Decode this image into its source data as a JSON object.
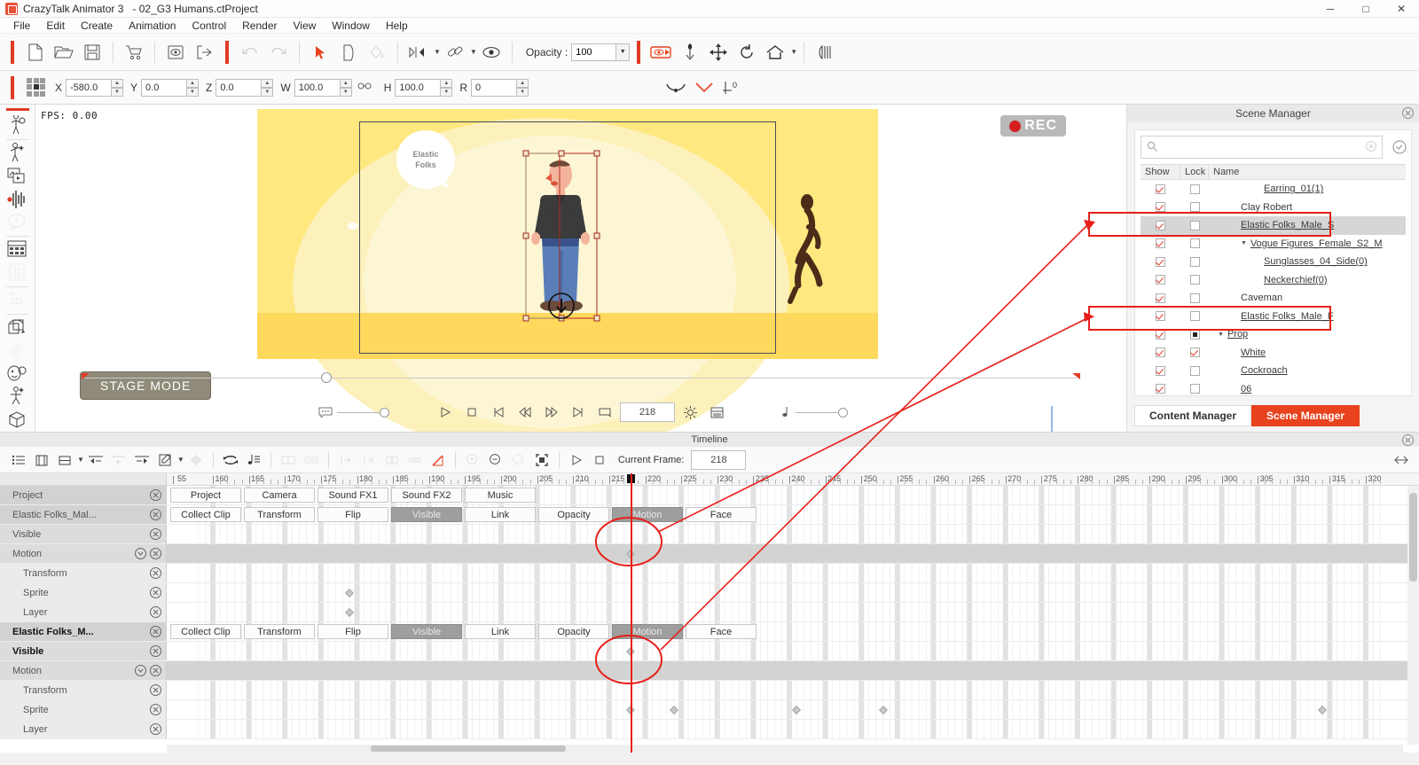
{
  "window": {
    "app_name": "CrazyTalk Animator 3",
    "document": "- 02_G3 Humans.ctProject",
    "minimize": "─",
    "maximize": "□",
    "close": "✕"
  },
  "menu": [
    "File",
    "Edit",
    "Create",
    "Animation",
    "Control",
    "Render",
    "View",
    "Window",
    "Help"
  ],
  "toolbar": {
    "opacity_label": "Opacity :",
    "opacity_value": "100",
    "icons": [
      "new-document-icon",
      "open-folder-icon",
      "save-disk-icon",
      "shopping-cart-icon",
      "preview-eye-icon",
      "export-icon",
      "undo-icon",
      "redo-icon",
      "select-arrow-icon",
      "duplicate-icon",
      "paint-bucket-icon",
      "keyframe-nav-icon",
      "link-bone-icon",
      "eye-visible-icon",
      "render-record-icon",
      "pin-icon",
      "move-icon",
      "rotate-icon",
      "home-icon",
      "composer-icon"
    ]
  },
  "transform": {
    "x_label": "X",
    "x_value": "-580.0",
    "y_label": "Y",
    "y_value": "0.0",
    "z_label": "Z",
    "z_value": "0.0",
    "w_label": "W",
    "w_value": "100.0",
    "h_label": "H",
    "h_value": "100.0",
    "r_label": "R",
    "r_value": "0",
    "zero_label": "0"
  },
  "rail": {
    "items": [
      {
        "name": "character-composer-icon",
        "enabled": true
      },
      {
        "name": "animation-puppet-icon",
        "enabled": true
      },
      {
        "name": "media-clip-icon",
        "enabled": true
      },
      {
        "name": "audio-waveform-icon",
        "enabled": true
      },
      {
        "name": "text-bubble-icon",
        "enabled": false
      },
      {
        "name": "sprite-editor-icon",
        "enabled": true
      },
      {
        "name": "bone-editor-icon",
        "enabled": false
      },
      {
        "name": "three-d-icon",
        "enabled": false
      },
      {
        "name": "layer-flip-icon",
        "enabled": true
      },
      {
        "name": "hand-gesture-icon",
        "enabled": false
      },
      {
        "name": "face-puppet-icon",
        "enabled": true
      },
      {
        "name": "motion-puppet-icon",
        "enabled": true
      },
      {
        "name": "box-prop-icon",
        "enabled": true
      }
    ]
  },
  "stage": {
    "fps": "FPS: 0.00",
    "rec_badge": "REC",
    "mode_badge": "STAGE MODE",
    "speech_bubble": "Elastic\nFolks",
    "speech_bubble_line1": "Elastic",
    "speech_bubble_line2": "Folks"
  },
  "transport": {
    "frame_value": "218",
    "buttons": [
      "play-icon",
      "stop-icon",
      "jump-start-icon",
      "step-back-icon",
      "step-forward-icon",
      "jump-end-icon",
      "loop-icon"
    ],
    "settings_icon": "gear-icon",
    "list_icon": "list-icon",
    "note_icon": "music-note-icon",
    "bubble_icon": "speech-bubble-icon"
  },
  "scene_manager": {
    "title": "Scene Manager",
    "search_placeholder": "",
    "search_value": "",
    "columns": [
      "Show",
      "Lock",
      "Name"
    ],
    "rows": [
      {
        "name": "Earring_01(1)",
        "show": true,
        "lock": false,
        "indent": 2,
        "expander": "",
        "selected": false,
        "highlight": false,
        "underline": true
      },
      {
        "name": "Clay Robert",
        "show": true,
        "lock": false,
        "indent": 1,
        "expander": "",
        "selected": false,
        "highlight": false,
        "underline": false
      },
      {
        "name": "Elastic Folks_Male_S",
        "show": true,
        "lock": false,
        "indent": 1,
        "expander": "",
        "selected": true,
        "highlight": true,
        "underline": true
      },
      {
        "name": "Vogue Figures_Female_S2_M",
        "show": true,
        "lock": false,
        "indent": 1,
        "expander": "▼",
        "selected": false,
        "highlight": false,
        "underline": true
      },
      {
        "name": "Sunglasses_04_Side(0)",
        "show": true,
        "lock": false,
        "indent": 2,
        "expander": "",
        "selected": false,
        "highlight": false,
        "underline": true
      },
      {
        "name": "Neckerchief(0)",
        "show": true,
        "lock": false,
        "indent": 2,
        "expander": "",
        "selected": false,
        "highlight": false,
        "underline": true
      },
      {
        "name": "Caveman",
        "show": true,
        "lock": false,
        "indent": 1,
        "expander": "",
        "selected": false,
        "highlight": false,
        "underline": false
      },
      {
        "name": "Elastic Folks_Male_F",
        "show": true,
        "lock": false,
        "indent": 1,
        "expander": "",
        "selected": false,
        "highlight": true,
        "underline": true
      },
      {
        "name": "Prop",
        "show": true,
        "lock": "square",
        "indent": 0,
        "expander": "▼",
        "selected": false,
        "highlight": false,
        "underline": true
      },
      {
        "name": "White",
        "show": true,
        "lock": true,
        "indent": 1,
        "expander": "",
        "selected": false,
        "highlight": false,
        "underline": true
      },
      {
        "name": "Cockroach",
        "show": true,
        "lock": false,
        "indent": 1,
        "expander": "",
        "selected": false,
        "highlight": false,
        "underline": true
      },
      {
        "name": "06",
        "show": true,
        "lock": false,
        "indent": 1,
        "expander": "",
        "selected": false,
        "highlight": false,
        "underline": true
      }
    ],
    "tabs": [
      {
        "label": "Content Manager",
        "active": false
      },
      {
        "label": "Scene Manager",
        "active": true
      }
    ]
  },
  "timeline": {
    "title": "Timeline",
    "current_frame_label": "Current Frame:",
    "current_frame_value": "218",
    "tool_icons": [
      "track-list-icon",
      "add-clip-icon",
      "collect-clip-icon",
      "shift-left-icon",
      "insert-frame-icon",
      "shift-right-icon",
      "edit-clip-icon",
      "mirror-icon",
      "loop-clip-icon",
      "audio-note-icon",
      "split-icon",
      "stretch-icon",
      "in-point-icon",
      "out-point-icon",
      "delete-range-icon",
      "dual-range-icon",
      "transition-curve-icon",
      "zoom-in-icon",
      "zoom-out-icon",
      "zoom-none-icon",
      "fit-icon",
      "play-icon",
      "stop-icon"
    ],
    "ruler": {
      "start": 55,
      "labels": [
        55,
        160,
        165,
        170,
        175,
        180,
        185,
        190,
        195,
        200,
        205,
        210,
        215,
        220,
        225,
        230,
        235,
        240,
        245,
        250,
        255,
        260,
        265,
        270,
        275,
        280,
        285,
        290,
        295,
        300,
        305,
        310,
        315,
        320
      ],
      "playhead_frame": 218
    },
    "tracks": [
      {
        "label": "Project",
        "type": "buttons",
        "indent": 0,
        "bold": false,
        "has_expander": false,
        "buttons": [
          {
            "label": "Project",
            "on": false
          },
          {
            "label": "Camera",
            "on": false
          },
          {
            "label": "Sound FX1",
            "on": false
          },
          {
            "label": "Sound FX2",
            "on": false
          },
          {
            "label": "Music",
            "on": false
          }
        ]
      },
      {
        "label": "Elastic Folks_Mal...",
        "type": "buttons",
        "indent": 0,
        "bold": false,
        "has_expander": false,
        "buttons": [
          {
            "label": "Collect Clip",
            "on": false
          },
          {
            "label": "Transform",
            "on": false
          },
          {
            "label": "Flip",
            "on": false
          },
          {
            "label": "Visible",
            "on": true
          },
          {
            "label": "Link",
            "on": false
          },
          {
            "label": "Opacity",
            "on": false
          },
          {
            "label": "Motion",
            "on": true
          },
          {
            "label": "Face",
            "on": false
          }
        ]
      },
      {
        "label": "Visible",
        "type": "grid",
        "indent": 0,
        "bold": false,
        "has_expander": false,
        "keys": []
      },
      {
        "label": "Motion",
        "type": "band",
        "indent": 0,
        "bold": false,
        "has_expander": true,
        "keys": [
          218
        ]
      },
      {
        "label": "Transform",
        "type": "grid",
        "indent": 1,
        "bold": false,
        "has_expander": false,
        "keys": []
      },
      {
        "label": "Sprite",
        "type": "grid",
        "indent": 1,
        "bold": false,
        "has_expander": false,
        "keys": [
          179
        ]
      },
      {
        "label": "Layer",
        "type": "grid",
        "indent": 1,
        "bold": false,
        "has_expander": false,
        "keys": [
          179
        ]
      },
      {
        "label": "Elastic Folks_M...",
        "type": "buttons",
        "indent": 0,
        "bold": true,
        "has_expander": false,
        "buttons": [
          {
            "label": "Collect Clip",
            "on": false
          },
          {
            "label": "Transform",
            "on": false
          },
          {
            "label": "Flip",
            "on": false
          },
          {
            "label": "Visible",
            "on": true
          },
          {
            "label": "Link",
            "on": false
          },
          {
            "label": "Opacity",
            "on": false
          },
          {
            "label": "Motion",
            "on": true
          },
          {
            "label": "Face",
            "on": false
          }
        ]
      },
      {
        "label": "Visible",
        "type": "grid",
        "indent": 0,
        "bold": true,
        "has_expander": false,
        "keys": [
          218
        ]
      },
      {
        "label": "Motion",
        "type": "band",
        "indent": 0,
        "bold": false,
        "has_expander": true,
        "keys": []
      },
      {
        "label": "Transform",
        "type": "grid",
        "indent": 1,
        "bold": false,
        "has_expander": false,
        "keys": []
      },
      {
        "label": "Sprite",
        "type": "grid",
        "indent": 1,
        "bold": false,
        "has_expander": false,
        "keys": [
          218,
          224,
          241,
          253,
          314
        ]
      },
      {
        "label": "Layer",
        "type": "grid",
        "indent": 1,
        "bold": false,
        "has_expander": false,
        "keys": []
      }
    ]
  },
  "colors": {
    "accent_red": "#e8421e",
    "playhead_red": "#e8201a",
    "stage_yellow": "#ffe87f",
    "stage_ground": "#ffd95e",
    "selected_gray": "#d6d6d6"
  }
}
